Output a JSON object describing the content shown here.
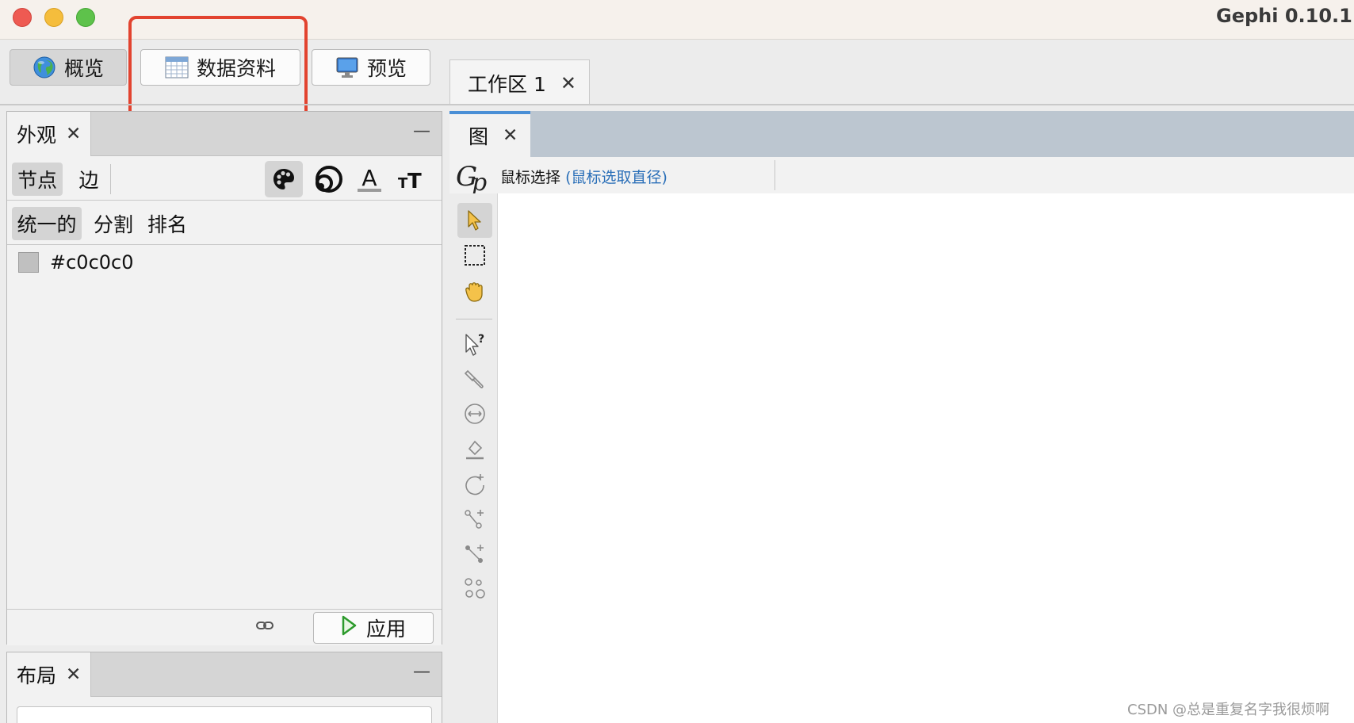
{
  "window": {
    "title": "Gephi 0.10.1 -"
  },
  "mode_tabs": [
    {
      "label": "概览",
      "icon": "globe-icon",
      "active": true
    },
    {
      "label": "数据资料",
      "icon": "spreadsheet-icon",
      "active": false
    },
    {
      "label": "预览",
      "icon": "monitor-icon",
      "active": false
    }
  ],
  "workspace_tab": {
    "label": "工作区 1",
    "close": "✕"
  },
  "appearance_panel": {
    "title": "外观",
    "close": "✕",
    "minimize": "—",
    "element_tabs": [
      "节点",
      "边"
    ],
    "element_tab_active": "节点",
    "attribute_icons": [
      "palette-icon",
      "size-rings-icon",
      "label-color-icon",
      "label-size-icon"
    ],
    "mode_tabs": [
      "统一的",
      "分割",
      "排名"
    ],
    "mode_tab_active": "统一的",
    "color_value": "#c0c0c0",
    "apply_label": "应用"
  },
  "layout_panel": {
    "title": "布局",
    "close": "✕",
    "minimize": "—"
  },
  "graph_window": {
    "tab_label": "图",
    "close": "✕",
    "selection_mode": "鼠标选择",
    "selection_detail": "(鼠标选取直径)",
    "tools": [
      "select-pointer-icon",
      "rectangle-select-icon",
      "hand-drag-icon",
      "edit-query-icon",
      "painter-icon",
      "size-icon",
      "fill-bucket-icon",
      "rotate-add-icon",
      "add-node-icon",
      "add-edge-icon",
      "shortest-path-icon"
    ]
  },
  "watermark": "CSDN @总是重复名字我很烦啊",
  "colors": {
    "highlight": "#e2432f",
    "accent": "#4a8fd6",
    "link": "#2a6fb8",
    "node_color": "#c0c0c0"
  }
}
